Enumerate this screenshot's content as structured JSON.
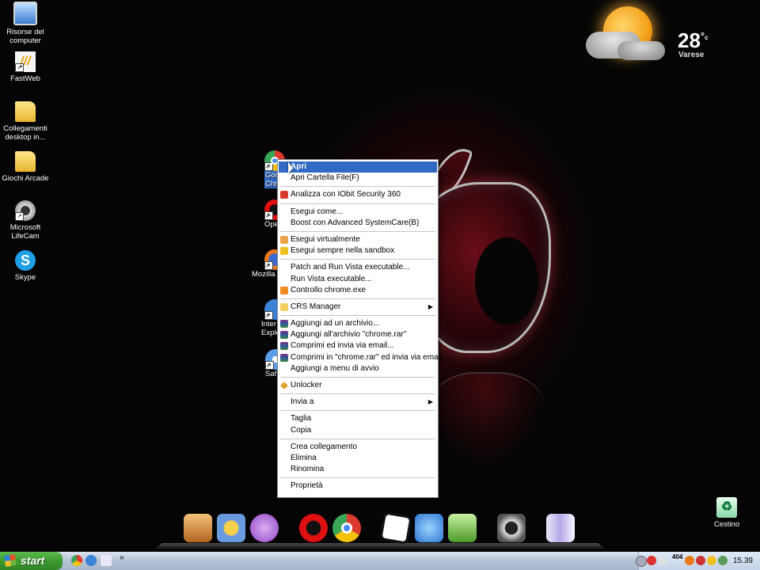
{
  "desktop_icons": [
    {
      "label": "Risorse del computer",
      "icon": "my-computer-icon"
    },
    {
      "label": "FastWeb",
      "icon": "fastweb-icon"
    },
    {
      "label": "Collegamenti desktop in...",
      "icon": "folder-icon"
    },
    {
      "label": "Giochi Arcade",
      "icon": "folder-icon"
    },
    {
      "label": "Microsoft LifeCam",
      "icon": "webcam-icon"
    },
    {
      "label": "Skype",
      "icon": "skype-icon"
    },
    {
      "label": "Cestino",
      "icon": "recycle-bin-icon"
    }
  ],
  "partial_icons": [
    {
      "label": "Goo",
      "label2": "Chro"
    },
    {
      "label": "Ope"
    },
    {
      "label": "Mozilla F"
    },
    {
      "label": "Inter",
      "label2": "Explo"
    },
    {
      "label": "Saf"
    }
  ],
  "weather": {
    "temperature": "28",
    "unit": "°",
    "unit_letter": "c",
    "city": "Varese"
  },
  "context_menu": {
    "items": [
      {
        "label": "Apri",
        "bold": true,
        "highlighted": true
      },
      {
        "label": "Apri Cartella File(F)"
      },
      {
        "sep": true
      },
      {
        "label": "Analizza con IObit Security 360",
        "icon": "iobit-icon"
      },
      {
        "sep": true
      },
      {
        "label": "Esegui come..."
      },
      {
        "label": "Boost con Advanced SystemCare(B)"
      },
      {
        "sep": true
      },
      {
        "label": "Esegui virtualmente",
        "icon": "lock-icon"
      },
      {
        "label": "Esegui sempre nella sandbox",
        "icon": "sandbox-icon"
      },
      {
        "sep": true
      },
      {
        "label": "Patch and Run Vista executable..."
      },
      {
        "label": "Run Vista executable..."
      },
      {
        "label": "Controllo chrome.exe",
        "icon": "control-icon"
      },
      {
        "sep": true
      },
      {
        "label": "CRS Manager",
        "icon": "crs-icon",
        "submenu": true
      },
      {
        "sep": true
      },
      {
        "label": "Aggiungi ad un archivio...",
        "icon": "winrar-icon"
      },
      {
        "label": "Aggiungi all'archivio \"chrome.rar\"",
        "icon": "winrar-icon"
      },
      {
        "label": "Comprimi ed invia via email...",
        "icon": "winrar-icon"
      },
      {
        "label": "Comprimi in \"chrome.rar\" ed invia via email",
        "icon": "winrar-icon"
      },
      {
        "label": "Aggiungi a menu di avvio"
      },
      {
        "sep": true
      },
      {
        "label": "Unlocker",
        "icon": "unlocker-icon"
      },
      {
        "sep": true
      },
      {
        "label": "Invia a",
        "submenu": true
      },
      {
        "sep": true
      },
      {
        "label": "Taglia"
      },
      {
        "label": "Copia"
      },
      {
        "sep": true
      },
      {
        "label": "Crea collegamento"
      },
      {
        "label": "Elimina"
      },
      {
        "label": "Rinomina"
      },
      {
        "sep": true
      },
      {
        "label": "Proprietà"
      }
    ]
  },
  "dock": [
    "ibooks-icon",
    "sunflower-icon",
    "itunes-icon",
    "opera-icon",
    "chrome-icon",
    "cube-icon",
    "app-store-icon",
    "messenger-icon",
    "camera-icon",
    "finder-icon"
  ],
  "taskbar": {
    "start_label": "start",
    "quicklaunch_more": "»",
    "tray_badge": "404",
    "clock": "15.39"
  }
}
